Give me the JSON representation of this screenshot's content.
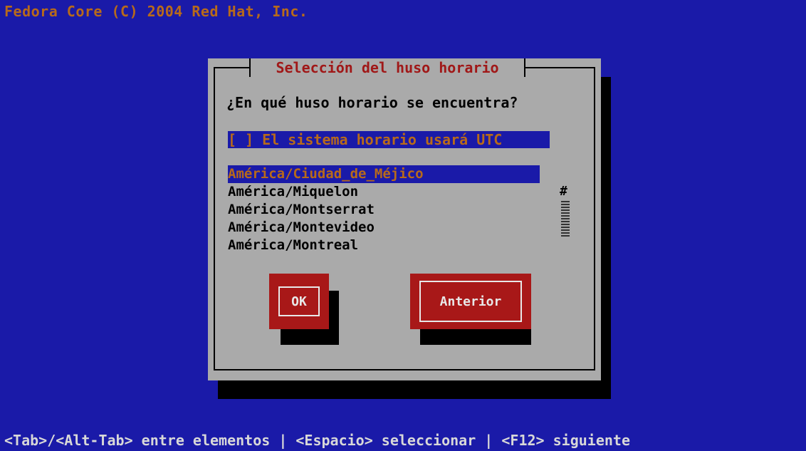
{
  "header": {
    "text": "Fedora Core (C) 2004 Red Hat, Inc."
  },
  "dialog": {
    "title": "Selección del huso horario",
    "question": "¿En qué huso horario se encuentra?",
    "utc_checkbox": "[ ] El sistema horario usará UTC",
    "timezones": [
      "América/Ciudad_de_Méjico",
      "América/Miquelon",
      "América/Montserrat",
      "América/Montevideo",
      "América/Montreal"
    ],
    "scroll_indicator": "#",
    "ok_label": "OK",
    "back_label": "Anterior"
  },
  "footer": {
    "help_text": "<Tab>/<Alt-Tab> entre elementos | <Espacio> seleccionar | <F12> siguiente"
  },
  "colors": {
    "background": "#1a1aa8",
    "dialog": "#aaaaaa",
    "button": "#a81818",
    "highlight_text": "#b86a1a"
  }
}
